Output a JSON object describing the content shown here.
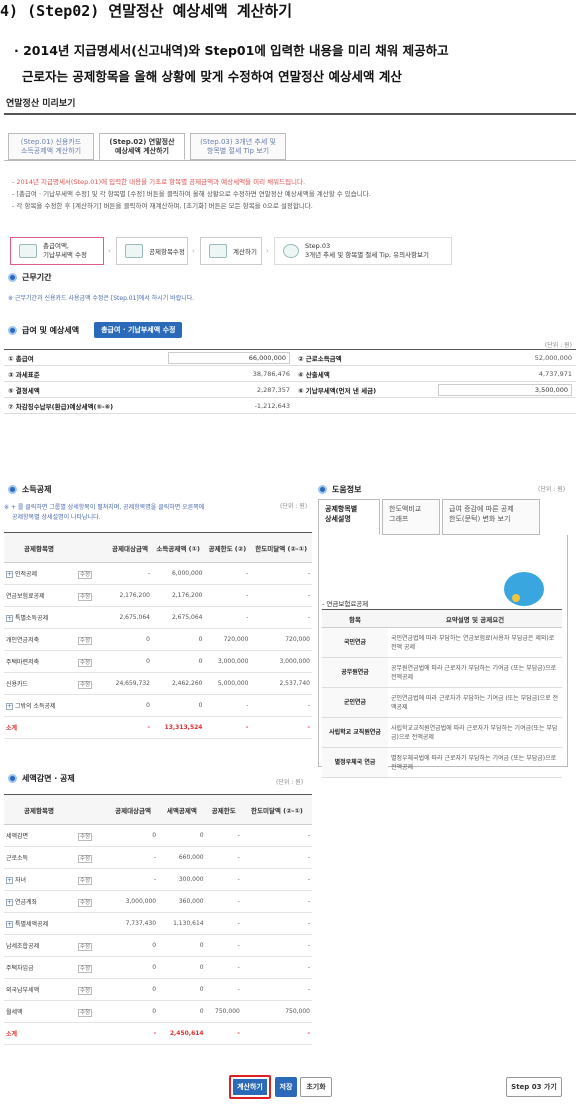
{
  "heading": "4) (Step02) 연말정산 예상세액 계산하기",
  "intro_line1": "· 2014년 지급명세서(신고내역)와 Step01에 입력한 내용을 미리 채워 제공하고",
  "intro_line2": "근로자는 공제항목을 올해 상황에 맞게 수정하여 연말정산 예상세액 계산",
  "section_title": "연말정산 미리보기",
  "steps": [
    {
      "l1": "(Step.01) 신용카드",
      "l2": "소득공제액 계산하기"
    },
    {
      "l1": "(Step.02) 연말정산",
      "l2": "예상세액 계산하기"
    },
    {
      "l1": "(Step.03) 3개년 추세 및",
      "l2": "항목별 절세 Tip 보기"
    }
  ],
  "notes": [
    "- 2014년 지급명세서(Step.01)에 입력한 내용을 기초로 항목별 공제금액과 예상세액을 미리 채워드립니다.",
    "- [총급여 · 기납부세액 수정] 및 각 항목별 [수정] 버튼을 클릭하여 올해 상황으로 수정하면 연말정산 예상세액을 계산할 수 있습니다.",
    "- 각 항목을 수정한 후 [계산하기] 버튼을 클릭하여 재계산하며, [초기화] 버튼은 모든 항목을 0으로 설정합니다."
  ],
  "workflow": [
    {
      "l1": "총급여액,",
      "l2": "기납부세액 수정"
    },
    {
      "l1": "공제항목수정",
      "l2": ""
    },
    {
      "l1": "계산하기",
      "l2": ""
    },
    {
      "l1": "Step.03",
      "l2": "3개년 추세 및 항목별 절세 Tip, 유의사항보기"
    }
  ],
  "period": {
    "title": "근무기간",
    "note": "※ 근무기간과 신용카드 사용금액 수정은 [Step.01]에서 하시기 바랍니다."
  },
  "salary": {
    "title": "급여 및 예상세액",
    "button": "총급여 · 기납부세액 수정",
    "unit": "(단위 : 원)",
    "rows": [
      {
        "l": "① 총급여",
        "lv": "66,000,000",
        "r": "② 근로소득금액",
        "rv": "52,000,000"
      },
      {
        "l": "③ 과세표준",
        "lv": "38,786,476",
        "r": "④ 산출세액",
        "rv": "4,737,971"
      },
      {
        "l": "⑤ 결정세액",
        "lv": "2,287,357",
        "r": "⑥ 기납부세액(먼저 낸 세금)",
        "rv": "3,500,000"
      },
      {
        "l": "⑦ 차감징수납부(환급)예상세액(⑤-⑥)",
        "lv": "-1,212,643",
        "r": "",
        "rv": ""
      }
    ]
  },
  "income_deduction": {
    "title": "소득공제",
    "unit": "(단위 : 원)",
    "note1": "※ + 를 클릭하면 그룹별 상세항목이 펼쳐지며, 공제항목명을 클릭하면 오른쪽에",
    "note2": "공제항목별 상세설명이 나타납니다.",
    "headers": [
      "공제항목명",
      "",
      "공제대상금액",
      "소득공제액 (①)",
      "공제한도 (②)",
      "한도미달액 (②-①)"
    ],
    "edit_label": "수정",
    "rows": [
      {
        "name": "인적공제",
        "plus": true,
        "edit": true,
        "a": "-",
        "b": "6,000,000",
        "c": "-",
        "d": "-"
      },
      {
        "name": "연금보험료공제",
        "plus": false,
        "edit": true,
        "a": "2,176,200",
        "b": "2,176,200",
        "c": "-",
        "d": "-"
      },
      {
        "name": "특별소득공제",
        "plus": true,
        "edit": false,
        "a": "2,675,064",
        "b": "2,675,064",
        "c": "-",
        "d": "-"
      },
      {
        "name": "개인연금저축",
        "plus": false,
        "edit": true,
        "a": "0",
        "b": "0",
        "c": "720,000",
        "d": "720,000"
      },
      {
        "name": "주택마련저축",
        "plus": false,
        "edit": true,
        "a": "0",
        "b": "0",
        "c": "3,000,000",
        "d": "3,000,000"
      },
      {
        "name": "신용카드",
        "plus": false,
        "edit": true,
        "a": "24,659,732",
        "b": "2,462,260",
        "c": "5,000,000",
        "d": "2,537,740"
      },
      {
        "name": "그밖의 소득공제",
        "plus": true,
        "edit": false,
        "a": "0",
        "b": "0",
        "c": "-",
        "d": "-"
      }
    ],
    "sum": {
      "name": "소계",
      "a": "-",
      "b": "13,313,524",
      "c": "-",
      "d": "-"
    }
  },
  "tax_credit": {
    "title": "세액감면 · 공제",
    "unit": "(단위 : 원)",
    "headers": [
      "공제항목명",
      "",
      "공제대상금액",
      "세액공제액",
      "공제한도",
      "한도미달액 (②-①)"
    ],
    "rows": [
      {
        "name": "세액감면",
        "plus": false,
        "edit": true,
        "a": "0",
        "b": "0",
        "c": "-",
        "d": "-"
      },
      {
        "name": "근로소득",
        "plus": false,
        "edit": true,
        "a": "-",
        "b": "660,000",
        "c": "-",
        "d": "-"
      },
      {
        "name": "자녀",
        "plus": true,
        "edit": true,
        "a": "-",
        "b": "300,000",
        "c": "-",
        "d": "-"
      },
      {
        "name": "연금계좌",
        "plus": true,
        "edit": true,
        "a": "3,000,000",
        "b": "360,000",
        "c": "-",
        "d": "-"
      },
      {
        "name": "특별세액공제",
        "plus": true,
        "edit": false,
        "a": "7,737,430",
        "b": "1,130,614",
        "c": "-",
        "d": "-"
      },
      {
        "name": "납세조합공제",
        "plus": false,
        "edit": true,
        "a": "0",
        "b": "0",
        "c": "-",
        "d": "-"
      },
      {
        "name": "주택차입금",
        "plus": false,
        "edit": true,
        "a": "0",
        "b": "0",
        "c": "-",
        "d": "-"
      },
      {
        "name": "외국납부세액",
        "plus": false,
        "edit": true,
        "a": "0",
        "b": "0",
        "c": "-",
        "d": "-"
      },
      {
        "name": "월세액",
        "plus": false,
        "edit": true,
        "a": "0",
        "b": "0",
        "c": "750,000",
        "d": "750,000"
      }
    ],
    "sum": {
      "name": "소계",
      "a": "-",
      "b": "2,450,614",
      "c": "-",
      "d": "-"
    }
  },
  "help": {
    "title": "도움정보",
    "unit": "(단위 : 원)",
    "tabs": [
      {
        "l1": "공제항목별",
        "l2": "상세설명"
      },
      {
        "l1": "한도액비교",
        "l2": "그래프"
      },
      {
        "l1": "급여 증감에 따른 공제",
        "l2": "한도(문턱) 변화 보기"
      }
    ],
    "subtitle": "- 연금보험료공제",
    "headers": [
      "항목",
      "요약설명 및 공제요건"
    ],
    "rows": [
      {
        "k": "국민연금",
        "v": "국민연금법에 따라 부담하는 연금보험료(사용자 부담금은 제외)로 전액 공제"
      },
      {
        "k": "공무원연금",
        "v": "공무원연금법에 따라 근로자가 부담하는 기여금 (또는 부담금)으로 전액공제"
      },
      {
        "k": "군인연금",
        "v": "군인연금법에 따라 근로자가 부담하는 기여금 (또는 부담금)으로 전액공제"
      },
      {
        "k": "사립학교 교직원연금",
        "v": "사립학교교직원연금법에 따라 근로자가 부담하는 기여금(또는 부담금)으로 전액공제"
      },
      {
        "k": "별정우체국 연금",
        "v": "별정우체국법에 따라 근로자가 부담하는 기여금 (또는 부담금)으로 전액공제"
      }
    ]
  },
  "buttons": {
    "calc": "계산하기",
    "save": "저장",
    "reset": "초기화",
    "next": "Step 03 가기"
  },
  "colors": {
    "accent": "#2a6ab8",
    "highlight": "#e02020",
    "sum": "#e03030"
  }
}
